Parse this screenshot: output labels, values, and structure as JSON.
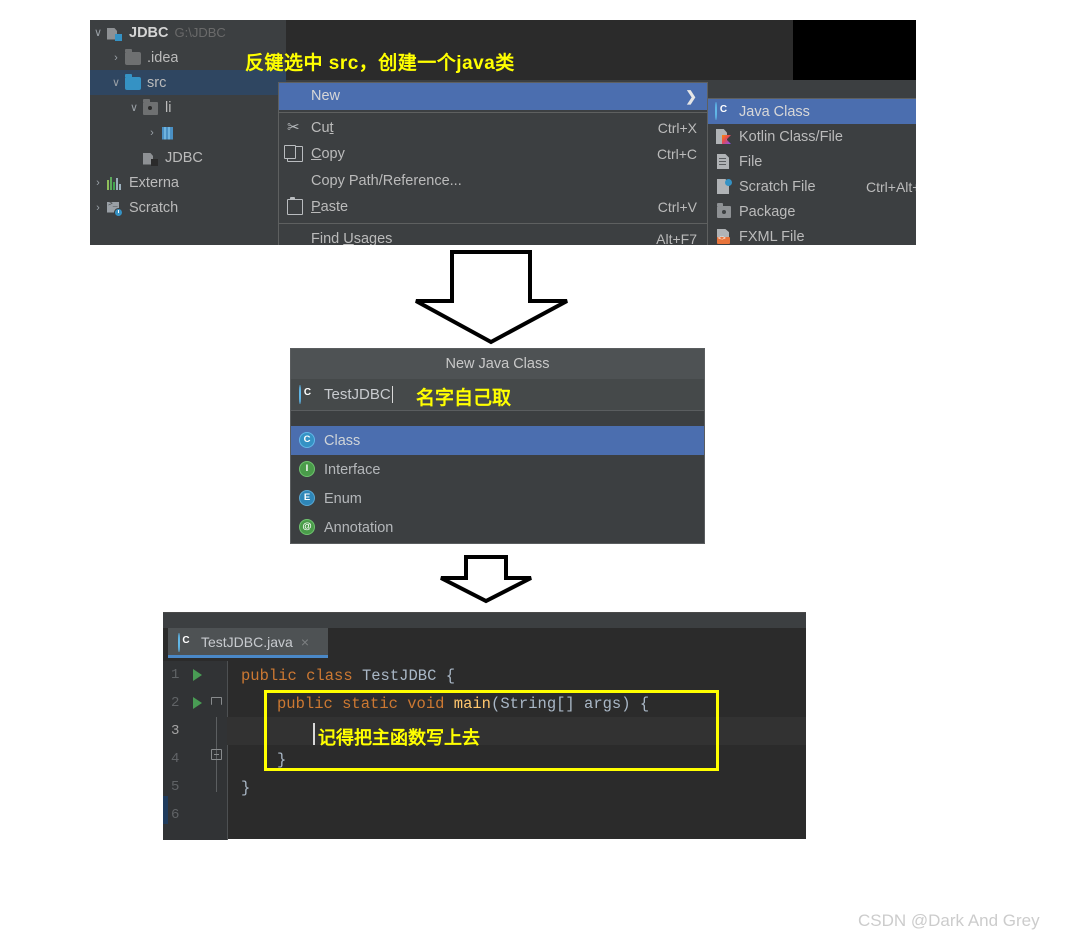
{
  "ide": {
    "project_tree": [
      {
        "chevron": "∨",
        "icon": "module-icon",
        "label": "JDBC",
        "path": "G:\\JDBC",
        "indent": 0,
        "selected": false,
        "bold": true
      },
      {
        "chevron": "›",
        "icon": "folder-icon",
        "label": ".idea",
        "path": "",
        "indent": 1,
        "selected": false,
        "bold": false
      },
      {
        "chevron": "∨",
        "icon": "folder-blue-icon",
        "label": "src",
        "path": "",
        "indent": 1,
        "selected": true,
        "bold": false
      },
      {
        "chevron": "∨",
        "icon": "library-icon",
        "label": "li",
        "path": "",
        "indent": 2,
        "selected": false,
        "bold": false
      },
      {
        "chevron": "›",
        "icon": "jar-icon",
        "label": "",
        "path": "",
        "indent": 3,
        "selected": false,
        "bold": false
      },
      {
        "chevron": "",
        "icon": "module-icon",
        "label": "JDBC",
        "path": "",
        "indent": 2,
        "selected": false,
        "bold": false
      },
      {
        "chevron": "›",
        "icon": "libraries-icon",
        "label": "Externa",
        "path": "",
        "indent": 0,
        "selected": false,
        "bold": false
      },
      {
        "chevron": "›",
        "icon": "scratch-icon",
        "label": "Scratch",
        "path": "",
        "indent": 0,
        "selected": false,
        "bold": false
      }
    ],
    "annotation_1": "反键选中 src，创建一个java类",
    "context_menu": [
      {
        "label": "New",
        "mnemonic": "",
        "accel": "",
        "icon": "",
        "highlighted": true,
        "submenu": true
      },
      {
        "label": "Cut",
        "mnemonic": "t",
        "accel": "Ctrl+X",
        "icon": "cut-icon",
        "highlighted": false,
        "submenu": false
      },
      {
        "label": "Copy",
        "mnemonic": "C",
        "accel": "Ctrl+C",
        "icon": "copy-icon",
        "highlighted": false,
        "submenu": false
      },
      {
        "label": "Copy Path/Reference...",
        "mnemonic": "",
        "accel": "",
        "icon": "",
        "highlighted": false,
        "submenu": false
      },
      {
        "label": "Paste",
        "mnemonic": "P",
        "accel": "Ctrl+V",
        "icon": "paste-icon",
        "highlighted": false,
        "submenu": false
      },
      {
        "label": "Find Usages",
        "mnemonic": "U",
        "accel": "Alt+F7",
        "icon": "",
        "highlighted": false,
        "submenu": false
      }
    ],
    "submenu": [
      {
        "label": "Java Class",
        "accel": "",
        "icon": "java-class-icon",
        "highlighted": true
      },
      {
        "label": "Kotlin Class/File",
        "accel": "",
        "icon": "kotlin-icon",
        "highlighted": false
      },
      {
        "label": "File",
        "accel": "",
        "icon": "file-icon",
        "highlighted": false
      },
      {
        "label": "Scratch File",
        "accel": "Ctrl+Alt+Shift+Inser",
        "icon": "scratch-file-icon",
        "highlighted": false
      },
      {
        "label": "Package",
        "accel": "",
        "icon": "package-icon",
        "highlighted": false
      },
      {
        "label": "FXML File",
        "accel": "",
        "icon": "fxml-icon",
        "highlighted": false
      }
    ]
  },
  "dialog": {
    "title": "New Java Class",
    "input_value": "TestJDBC",
    "input_icon": "java-class-icon",
    "annotation_2": "名字自己取",
    "options": [
      {
        "label": "Class",
        "icon": "class-icon",
        "glyph": "C",
        "selected": true
      },
      {
        "label": "Interface",
        "icon": "interface-icon",
        "glyph": "I",
        "selected": false
      },
      {
        "label": "Enum",
        "icon": "enum-icon",
        "glyph": "E",
        "selected": false
      },
      {
        "label": "Annotation",
        "icon": "annotation-icon",
        "glyph": "@",
        "selected": false
      }
    ]
  },
  "editor": {
    "tab_label": "TestJDBC.java",
    "tab_icon": "java-class-icon",
    "tab_close": "×",
    "line_numbers": [
      "1",
      "2",
      "3",
      "4",
      "5",
      "6"
    ],
    "code_lines": [
      {
        "n": 1,
        "indent": 0,
        "tokens": [
          {
            "t": "public",
            "c": "kw"
          },
          {
            "t": " ",
            "c": "id"
          },
          {
            "t": "class",
            "c": "kw"
          },
          {
            "t": " ",
            "c": "id"
          },
          {
            "t": "TestJDBC",
            "c": "typ"
          },
          {
            "t": " ",
            "c": "id"
          },
          {
            "t": "{",
            "c": "br"
          }
        ]
      },
      {
        "n": 2,
        "indent": 1,
        "tokens": [
          {
            "t": "public",
            "c": "kw"
          },
          {
            "t": " ",
            "c": "id"
          },
          {
            "t": "static",
            "c": "kw"
          },
          {
            "t": " ",
            "c": "id"
          },
          {
            "t": "void",
            "c": "kw"
          },
          {
            "t": " ",
            "c": "id"
          },
          {
            "t": "main",
            "c": "fn"
          },
          {
            "t": "(",
            "c": "br"
          },
          {
            "t": "String",
            "c": "typ"
          },
          {
            "t": "[] ",
            "c": "br"
          },
          {
            "t": "args",
            "c": "id"
          },
          {
            "t": ") ",
            "c": "br"
          },
          {
            "t": "{",
            "c": "br"
          }
        ]
      },
      {
        "n": 3,
        "indent": 2,
        "tokens": []
      },
      {
        "n": 4,
        "indent": 1,
        "tokens": [
          {
            "t": "}",
            "c": "br"
          }
        ]
      },
      {
        "n": 5,
        "indent": 0,
        "tokens": [
          {
            "t": "}",
            "c": "br"
          }
        ]
      },
      {
        "n": 6,
        "indent": 0,
        "tokens": []
      }
    ],
    "annotation_3": "记得把主函数写上去"
  },
  "watermark": "CSDN @Dark And Grey",
  "colors": {
    "panel_bg": "#3c3f41",
    "editor_bg": "#2b2b2b",
    "highlight_blue": "#4b6eaf",
    "annotation_yellow": "#ffff00",
    "keyword_orange": "#cc7832",
    "method_yellow": "#ffc66d",
    "identifier_grey": "#a9b7c6",
    "tab_underline": "#4a88c7"
  }
}
